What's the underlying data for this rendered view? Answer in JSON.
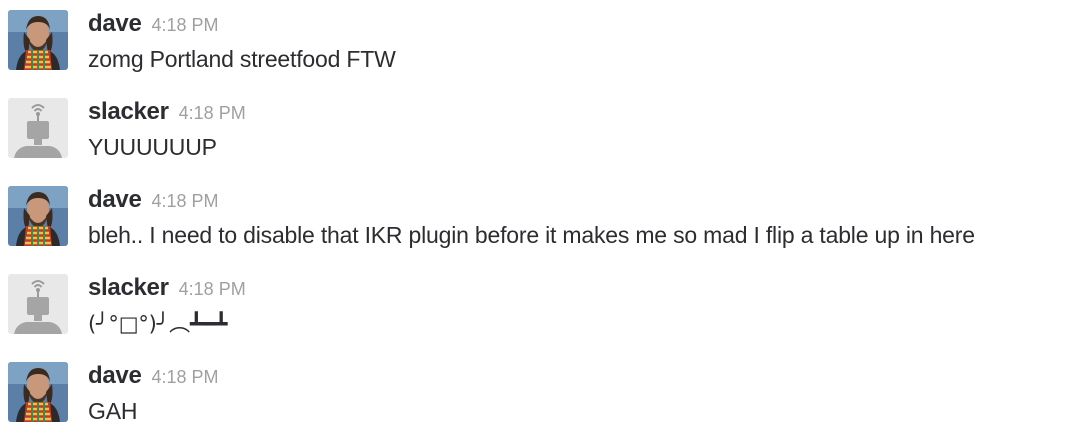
{
  "messages": [
    {
      "author": "dave",
      "timestamp": "4:18 PM",
      "text": "zomg Portland streetfood FTW",
      "avatar": "user-photo-avatar"
    },
    {
      "author": "slacker",
      "timestamp": "4:18 PM",
      "text": "YUUUUUUP",
      "avatar": "bot-robot-avatar"
    },
    {
      "author": "dave",
      "timestamp": "4:18 PM",
      "text": "bleh.. I need to disable that IKR plugin before it makes me so mad I flip a table up in here",
      "avatar": "user-photo-avatar"
    },
    {
      "author": "slacker",
      "timestamp": "4:18 PM",
      "text": "(╯°□°)╯︵┻━┻",
      "avatar": "bot-robot-avatar"
    },
    {
      "author": "dave",
      "timestamp": "4:18 PM",
      "text": "GAH",
      "avatar": "user-photo-avatar"
    }
  ],
  "colors": {
    "author": "#2c2d30",
    "timestamp": "#a0a0a2",
    "text": "#2c2d30",
    "bot_avatar_bg": "#e8e8e8",
    "bot_avatar_fg": "#9a9a9a"
  }
}
